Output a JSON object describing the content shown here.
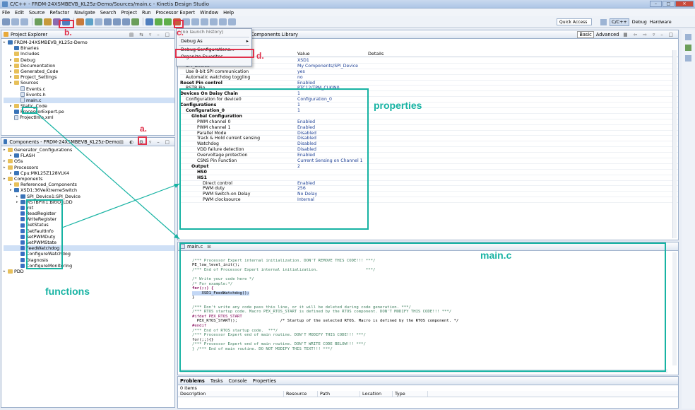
{
  "window": {
    "title": "C/C++ - FRDM-24XSMBEVB_KL25z-Demo/Sources/main.c - Kinetis Design Studio"
  },
  "menubar": [
    "File",
    "Edit",
    "Source",
    "Refactor",
    "Navigate",
    "Search",
    "Project",
    "Run",
    "Processor Expert",
    "Window",
    "Help"
  ],
  "toolbar_right": {
    "quick_access": "Quick Access",
    "persp_cpp": "C/C++",
    "persp_debug": "Debug",
    "persp_hw": "Hardware"
  },
  "project_explorer": {
    "tab": "Project Explorer",
    "items": [
      {
        "label": "FRDM-24XSMBEVB_KL25z-Demo",
        "indent": 0,
        "icon": "project"
      },
      {
        "label": "Binaries",
        "indent": 1,
        "icon": "bin"
      },
      {
        "label": "Includes",
        "indent": 1,
        "icon": "inc"
      },
      {
        "label": "Debug",
        "indent": 1,
        "icon": "folder"
      },
      {
        "label": "Documentation",
        "indent": 1,
        "icon": "folder"
      },
      {
        "label": "Generated_Code",
        "indent": 1,
        "icon": "folder"
      },
      {
        "label": "Project_Settings",
        "indent": 1,
        "icon": "folder"
      },
      {
        "label": "Sources",
        "indent": 1,
        "icon": "folder"
      },
      {
        "label": "Events.c",
        "indent": 2,
        "icon": "file"
      },
      {
        "label": "Events.h",
        "indent": 2,
        "icon": "file"
      },
      {
        "label": "main.c",
        "indent": 2,
        "icon": "file"
      },
      {
        "label": "Static_Code",
        "indent": 1,
        "icon": "folder"
      },
      {
        "label": "ProcessorExpert.pe",
        "indent": 1,
        "icon": "pe"
      },
      {
        "label": "ProjectInfo.xml",
        "indent": 1,
        "icon": "file"
      }
    ]
  },
  "components": {
    "tab": "Components - FRDM-24XSMBEVB_KL25z-Demo",
    "items": [
      {
        "label": "Generator_Configurations",
        "indent": 0,
        "icon": "folder"
      },
      {
        "label": "FLASH",
        "indent": 1,
        "icon": "comp"
      },
      {
        "label": "OSs",
        "indent": 0,
        "icon": "folder"
      },
      {
        "label": "Processors",
        "indent": 0,
        "icon": "folder"
      },
      {
        "label": "Cpu:MKL25Z128VLK4",
        "indent": 1,
        "icon": "comp"
      },
      {
        "label": "Components",
        "indent": 0,
        "icon": "folder"
      },
      {
        "label": "Referenced_Components",
        "indent": 1,
        "icon": "folder"
      },
      {
        "label": "XSD1:36VeXtremeSwitch",
        "indent": 1,
        "icon": "comp"
      },
      {
        "label": "SPI_Device1:SPI_Device",
        "indent": 2,
        "icon": "comp"
      },
      {
        "label": "RSTBPin1:BitIO_LDD",
        "indent": 2,
        "icon": "comp"
      },
      {
        "label": "Init",
        "indent": 2,
        "icon": "method"
      },
      {
        "label": "ReadRegister",
        "indent": 2,
        "icon": "method"
      },
      {
        "label": "WriteRegister",
        "indent": 2,
        "icon": "method"
      },
      {
        "label": "GetStatus",
        "indent": 2,
        "icon": "method"
      },
      {
        "label": "GetFaultInfo",
        "indent": 2,
        "icon": "method"
      },
      {
        "label": "SetPWMDuty",
        "indent": 2,
        "icon": "method"
      },
      {
        "label": "SetPWMState",
        "indent": 2,
        "icon": "method"
      },
      {
        "label": "FeedWatchdog",
        "indent": 2,
        "icon": "method"
      },
      {
        "label": "ConfigureWatchdog",
        "indent": 2,
        "icon": "method"
      },
      {
        "label": "Diagnosis",
        "indent": 2,
        "icon": "method"
      },
      {
        "label": "ConfigureMonitoring",
        "indent": 2,
        "icon": "method"
      },
      {
        "label": "PDD",
        "indent": 0,
        "icon": "folder"
      }
    ]
  },
  "launch_menu": {
    "items": [
      "(no launch history)",
      "Debug As",
      "Debug Configurations...",
      "Organize Favorites..."
    ]
  },
  "inspector": {
    "tab_library": "Components Library",
    "basic": "Basic",
    "advanced": "Advanced",
    "headers": [
      "Value",
      "Details"
    ],
    "rows": [
      {
        "name": "",
        "value": "XSD1",
        "indent": 1
      },
      {
        "name": "SPI_Device",
        "value": "My Components/SPI_Device",
        "indent": 1
      },
      {
        "name": "Use 8-bit SPI communication",
        "value": "yes",
        "indent": 1
      },
      {
        "name": "Automatic watchdog toggling",
        "value": "no",
        "indent": 1
      },
      {
        "name": "Reset Pin control",
        "value": "Enabled",
        "indent": 0,
        "group": true
      },
      {
        "name": "RSTB Pin",
        "value": "PTC12/TPM_CLKIN0",
        "indent": 1
      },
      {
        "name": "Devices On Daisy Chain",
        "value": "1",
        "indent": 0,
        "group": true
      },
      {
        "name": "Configuration for device0",
        "value": "Configuration_0",
        "indent": 1
      },
      {
        "name": "Configurations",
        "value": "1",
        "indent": 0,
        "group": true
      },
      {
        "name": "Configuration_0",
        "value": "1",
        "indent": 1,
        "group": true
      },
      {
        "name": "Global Configuration",
        "value": "",
        "indent": 2,
        "group": true
      },
      {
        "name": "PWM channel 0",
        "value": "Enabled",
        "indent": 3
      },
      {
        "name": "PWM channel 1",
        "value": "Enabled",
        "indent": 3
      },
      {
        "name": "Parallel Mode",
        "value": "Disabled",
        "indent": 3
      },
      {
        "name": "Track & Hold current sensing",
        "value": "Disabled",
        "indent": 3
      },
      {
        "name": "Watchdog",
        "value": "Disabled",
        "indent": 3
      },
      {
        "name": "VDD failure detection",
        "value": "Disabled",
        "indent": 3
      },
      {
        "name": "Overvoltage protection",
        "value": "Enabled",
        "indent": 3
      },
      {
        "name": "CSNS Pin Function",
        "value": "Current Sensing on Channel 1",
        "indent": 3
      },
      {
        "name": "Output",
        "value": "2",
        "indent": 2,
        "group": true
      },
      {
        "name": "HS0",
        "value": "",
        "indent": 3,
        "group": true
      },
      {
        "name": "HS1",
        "value": "",
        "indent": 3,
        "group": true
      },
      {
        "name": "Direct control",
        "value": "Enabled",
        "indent": 4
      },
      {
        "name": "PWM duty",
        "value": "256",
        "indent": 4
      },
      {
        "name": "PWM Switch-on Delay",
        "value": "No Delay",
        "indent": 4
      },
      {
        "name": "PWM clocksource",
        "value": "Internal",
        "indent": 4
      }
    ]
  },
  "editor": {
    "tab": "main.c",
    "lines": [
      {
        "t": "",
        "c": ""
      },
      {
        "t": "/*** Processor Expert internal initialization. DON'T REMOVE THIS CODE!!! ***/",
        "c": "cmt"
      },
      {
        "t": "PE_low_level_init();",
        "c": ""
      },
      {
        "t": "/*** End of Processor Expert internal initialization.                    ***/",
        "c": "cmt"
      },
      {
        "t": "",
        "c": ""
      },
      {
        "t": "/* Write your code here */",
        "c": "cmt"
      },
      {
        "t": "/* For example:*/",
        "c": "cmt"
      },
      {
        "t": "for(;;) {",
        "c": "kw"
      },
      {
        "t": "    XSD1_FeedWatchdog();",
        "c": "hl"
      },
      {
        "t": "}",
        "c": ""
      },
      {
        "t": "",
        "c": ""
      },
      {
        "t": "/*** Don't write any code pass this line, or it will be deleted during code generation. ***/",
        "c": "cmt"
      },
      {
        "t": "/*** RTOS startup code. Macro PEX_RTOS_START is defined by the RTOS component. DON'T MODIFY THIS CODE!!! ***/",
        "c": "cmt"
      },
      {
        "t": "#ifdef PEX_RTOS_START",
        "c": "pp"
      },
      {
        "t": "  PEX_RTOS_START();                  /* Startup of the selected RTOS. Macro is defined by the RTOS component. */",
        "c": ""
      },
      {
        "t": "#endif",
        "c": "pp"
      },
      {
        "t": "/*** End of RTOS startup code.  ***/",
        "c": "cmt"
      },
      {
        "t": "/*** Processor Expert end of main routine. DON'T MODIFY THIS CODE!!! ***/",
        "c": "cmt"
      },
      {
        "t": "for(;;){}",
        "c": ""
      },
      {
        "t": "/*** Processor Expert end of main routine. DON'T WRITE CODE BELOW!!! ***/",
        "c": "cmt"
      },
      {
        "t": "} /*** End of main routine. DO NOT MODIFY THIS TEXT!!! ***/",
        "c": "cmt"
      }
    ]
  },
  "problems": {
    "tabs": [
      "Problems",
      "Tasks",
      "Console",
      "Properties"
    ],
    "count": "0 items",
    "headers": [
      "Description",
      "Resource",
      "Path",
      "Location",
      "Type"
    ]
  },
  "annotations": {
    "a": "a.",
    "b": "b.",
    "c": "c.",
    "d": "d.",
    "properties": "properties",
    "mainc": "main.c",
    "functions": "functions"
  },
  "colors": {
    "annotation_red": "#e0304a",
    "annotation_teal": "#17b3a3"
  }
}
